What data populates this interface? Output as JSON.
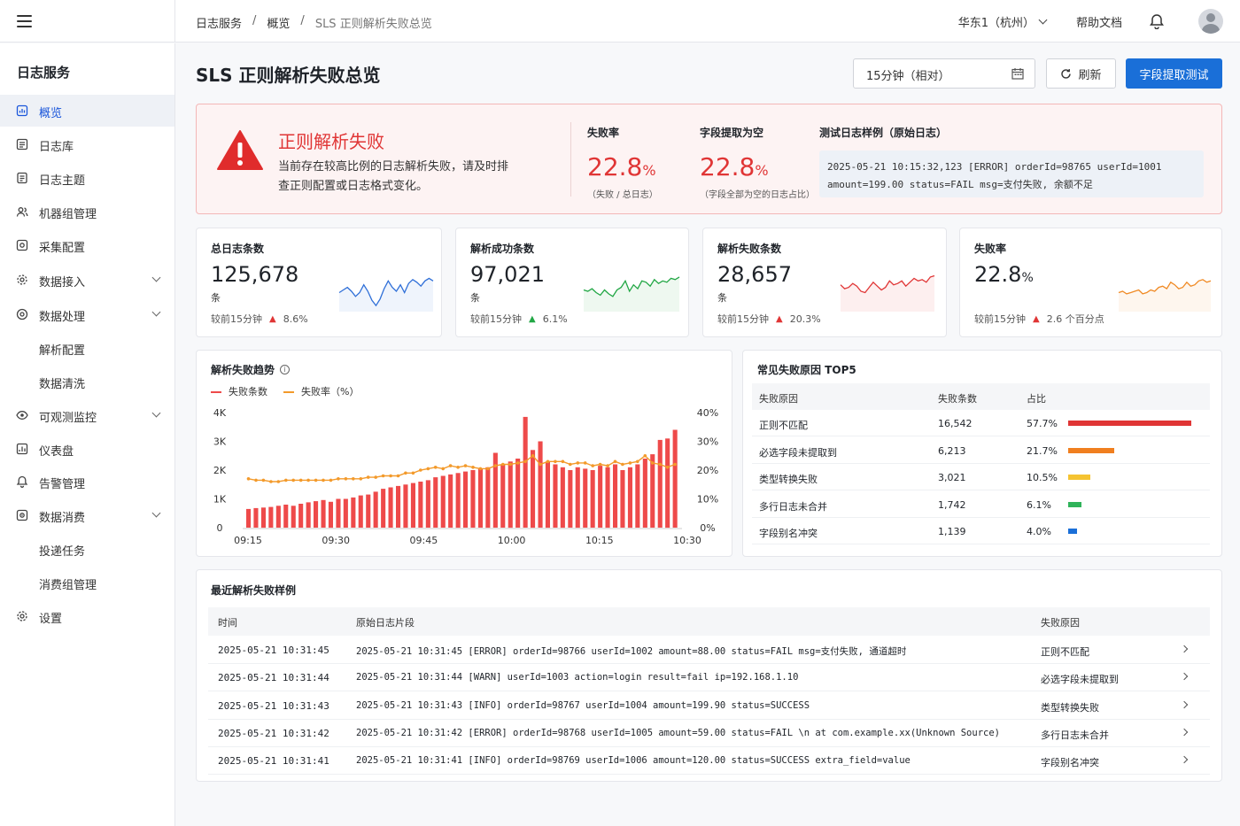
{
  "topbar": {
    "breadcrumbs": [
      "日志服务",
      "概览",
      "SLS 正则解析失败总览"
    ],
    "breadcrumb_sep": "/",
    "region": "华东1（杭州）",
    "help": "帮助文档"
  },
  "sidebar": {
    "title": "日志服务",
    "items": [
      {
        "label": "概览",
        "icon": "dashboard-icon"
      },
      {
        "label": "日志库",
        "icon": "list-icon"
      },
      {
        "label": "日志主题",
        "icon": "file-icon"
      },
      {
        "label": "机器组管理",
        "icon": "users-icon"
      },
      {
        "label": "采集配置",
        "icon": "collect-icon"
      },
      {
        "label": "数据接入",
        "icon": "gear-icon"
      },
      {
        "label": "数据处理",
        "icon": "process-icon"
      },
      {
        "label": "解析配置",
        "icon": ""
      },
      {
        "label": "数据清洗",
        "icon": ""
      },
      {
        "label": "可观测监控",
        "icon": "eye-icon"
      },
      {
        "label": "仪表盘",
        "icon": "chart-icon"
      },
      {
        "label": "告警管理",
        "icon": "bell-icon"
      },
      {
        "label": "数据消费",
        "icon": "consume-icon"
      },
      {
        "label": "投递任务",
        "icon": ""
      },
      {
        "label": "消费组管理",
        "icon": ""
      },
      {
        "label": "设置",
        "icon": "settings-icon"
      }
    ]
  },
  "header": {
    "title": "SLS 正则解析失败总览",
    "time_range": "15分钟（相对）",
    "refresh": "刷新",
    "primary": "字段提取测试"
  },
  "alert": {
    "title": "正则解析失败",
    "desc": "当前存在较高比例的日志解析失败，请及时排查正则配置或日志格式变化。",
    "fail_rate_label": "失败率",
    "fail_rate_value": "22.8",
    "fail_rate_unit": "%",
    "fail_rate_sub": "（失败 / 总日志）",
    "empty_label": "字段提取为空",
    "empty_value": "22.8",
    "empty_unit": "%",
    "empty_sub": "（字段全部为空的日志占比）",
    "sample_label": "测试日志样例（原始日志）",
    "sample_line1": "2025-05-21 10:15:32,123 [ERROR] orderId=98765 userId=1001",
    "sample_line2": "amount=199.00 status=FAIL msg=支付失败, 余额不足"
  },
  "stats": [
    {
      "title": "总日志条数",
      "value": "125,678",
      "unit": "条",
      "cmp_label": "较前15分钟",
      "delta": "8.6%",
      "color": "#2f6fd8"
    },
    {
      "title": "解析成功条数",
      "value": "97,021",
      "unit": "条",
      "cmp_label": "较前15分钟",
      "delta": "6.1%",
      "color": "#22a745"
    },
    {
      "title": "解析失败条数",
      "value": "28,657",
      "unit": "条",
      "cmp_label": "较前15分钟",
      "delta": "20.3%",
      "color": "#e03535"
    },
    {
      "title": "失败率",
      "value": "22.8",
      "value_unit": "%",
      "unit": "",
      "cmp_label": "较前15分钟",
      "delta": "2.6 个百分点",
      "color": "#f08a24"
    }
  ],
  "trend": {
    "title": "解析失败趋势",
    "legend_count": "失败条数",
    "legend_rate": "失败率（%）",
    "count_color": "#ee4a4a",
    "rate_color": "#f39a2b"
  },
  "chart_data": {
    "type": "bar",
    "title": "解析失败趋势",
    "x_ticks": [
      "09:15",
      "09:30",
      "09:45",
      "10:00",
      "10:15",
      "10:30"
    ],
    "y_ticks_left": [
      "0",
      "1K",
      "2K",
      "3K",
      "4K"
    ],
    "y_ticks_right": [
      "0%",
      "10%",
      "20%",
      "30%",
      "40%"
    ],
    "ylim": [
      0,
      4000
    ],
    "y2lim": [
      0,
      40
    ],
    "series": [
      {
        "name": "失败条数",
        "values": [
          650,
          680,
          700,
          720,
          760,
          800,
          760,
          830,
          880,
          920,
          960,
          900,
          1000,
          1000,
          1050,
          1120,
          1150,
          1250,
          1350,
          1400,
          1450,
          1500,
          1550,
          1600,
          1650,
          1750,
          1800,
          1850,
          1900,
          1950,
          2000,
          2050,
          2100,
          2600,
          2200,
          2300,
          2400,
          3850,
          2700,
          3000,
          2300,
          2200,
          2100,
          2000,
          2100,
          2050,
          2000,
          2150,
          2100,
          2200,
          2000,
          2100,
          2200,
          2400,
          2550,
          3050,
          3100,
          3400
        ]
      },
      {
        "name": "失败率（%）",
        "values": [
          17,
          16.5,
          16.5,
          16,
          16,
          16.5,
          16.5,
          16.5,
          16.5,
          16.5,
          16.5,
          16.5,
          17,
          17,
          17,
          17,
          17.5,
          17.5,
          18,
          18,
          18,
          19,
          19,
          20,
          20.5,
          21,
          20.5,
          21.5,
          21,
          21.5,
          21,
          20.5,
          20.5,
          21.5,
          22,
          22,
          22.5,
          23,
          25,
          22,
          23,
          23,
          23,
          22,
          22.5,
          22.5,
          21.5,
          22,
          21.5,
          23,
          22,
          22.5,
          23,
          25,
          22.5,
          22,
          21,
          22
        ]
      }
    ]
  },
  "top5": {
    "title": "常见失败原因 TOP5",
    "headers": [
      "失败原因",
      "失败条数",
      "占比"
    ],
    "rows": [
      {
        "reason": "正则不匹配",
        "count": "16,542",
        "pct": "57.7%",
        "ratio": 0.577,
        "color": "#e03535"
      },
      {
        "reason": "必选字段未提取到",
        "count": "6,213",
        "pct": "21.7%",
        "ratio": 0.217,
        "color": "#f07f1f"
      },
      {
        "reason": "类型转换失败",
        "count": "3,021",
        "pct": "10.5%",
        "ratio": 0.105,
        "color": "#f5c331"
      },
      {
        "reason": "多行日志未合并",
        "count": "1,742",
        "pct": "6.1%",
        "ratio": 0.061,
        "color": "#2fb35a"
      },
      {
        "reason": "字段别名冲突",
        "count": "1,139",
        "pct": "4.0%",
        "ratio": 0.04,
        "color": "#1a6fd8"
      }
    ]
  },
  "recent": {
    "title": "最近解析失败样例",
    "headers": [
      "时间",
      "原始日志片段",
      "失败原因"
    ],
    "rows": [
      {
        "time": "2025-05-21 10:31:45",
        "raw": "2025-05-21 10:31:45 [ERROR] orderId=98766 userId=1002 amount=88.00 status=FAIL msg=支付失败, 通道超时",
        "reason": "正则不匹配"
      },
      {
        "time": "2025-05-21 10:31:44",
        "raw": "2025-05-21 10:31:44 [WARN] userId=1003 action=login result=fail ip=192.168.1.10",
        "reason": "必选字段未提取到"
      },
      {
        "time": "2025-05-21 10:31:43",
        "raw": "2025-05-21 10:31:43 [INFO] orderId=98767 userId=1004 amount=199.90 status=SUCCESS",
        "reason": "类型转换失败"
      },
      {
        "time": "2025-05-21 10:31:42",
        "raw": "2025-05-21 10:31:42 [ERROR] orderId=98768 userId=1005 amount=59.00 status=FAIL \\n    at com.example.xx(Unknown Source)",
        "reason": "多行日志未合并"
      },
      {
        "time": "2025-05-21 10:31:41",
        "raw": "2025-05-21 10:31:41 [INFO] orderId=98769 userId=1006 amount=120.00 status=SUCCESS extra_field=value",
        "reason": "字段别名冲突"
      }
    ]
  }
}
